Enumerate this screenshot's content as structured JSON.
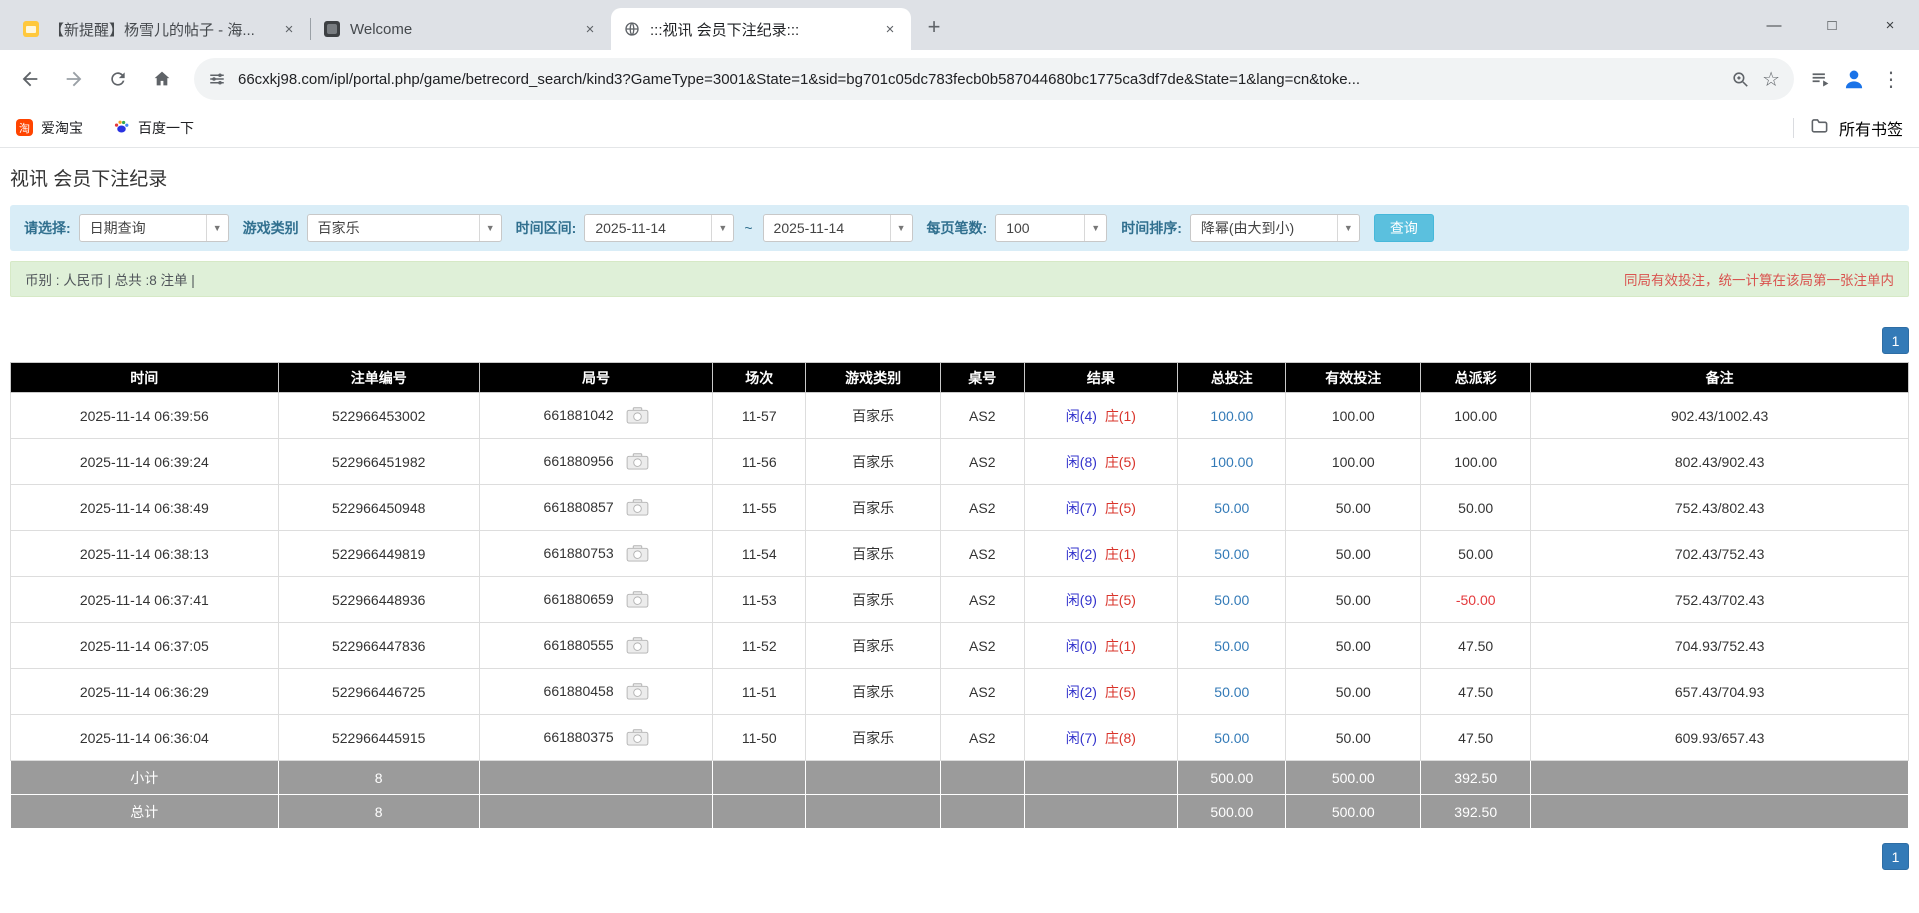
{
  "colors": {
    "accent_blue": "#337ab7",
    "filter_bg": "#d9edf7",
    "info_bg": "#dff0d8",
    "header_bg": "#000000",
    "summary_bg": "#9b9b9b",
    "player_blue": "#3333cc",
    "banker_red": "#d9342b",
    "negative_red": "#e4393c",
    "search_btn": "#5bc0de"
  },
  "icons": {
    "dropdown": "▼",
    "close": "×",
    "minimize": "—",
    "maximize": "□",
    "new_tab": "+",
    "star": "☆",
    "kebab": "⋮"
  },
  "browser": {
    "tabs": [
      {
        "title": "【新提醒】杨雪儿的帖子 - 海..."
      },
      {
        "title": "Welcome"
      },
      {
        "title": ":::视讯 会员下注纪录:::"
      }
    ],
    "omnibox": {
      "url": "66cxkj98.com/ipl/portal.php/game/betrecord_search/kind3?GameType=3001&State=1&sid=bg701c05dc783fecb0b587044680bc1775ca3df7de&State=1&lang=cn&toke..."
    },
    "bookmarks": {
      "items": [
        {
          "label": "爱淘宝",
          "badge": "淘"
        },
        {
          "label": "百度一下"
        }
      ],
      "all_bookmarks": "所有书签"
    }
  },
  "page": {
    "title": "视讯 会员下注纪录",
    "filters": {
      "select_label": "请选择:",
      "select_value": "日期查询",
      "game_type_label": "游戏类别",
      "game_type_value": "百家乐",
      "date_range_label": "时间区间:",
      "date_from": "2025-11-14",
      "date_to": "2025-11-14",
      "tilde": "~",
      "page_size_label": "每页笔数:",
      "page_size_value": "100",
      "sort_label": "时间排序:",
      "sort_value": "降幂(由大到小)",
      "search_button": "查询"
    },
    "info_bar": {
      "left": "币别 : 人民币 | 总共 :8 注单 |",
      "right": "同局有效投注，统一计算在该局第一张注单内"
    },
    "pagination": "1",
    "table": {
      "headers": [
        "时间",
        "注单编号",
        "局号",
        "场次",
        "游戏类别",
        "桌号",
        "结果",
        "总投注",
        "有效投注",
        "总派彩",
        "备注"
      ],
      "rows": [
        {
          "time": "2025-11-14 06:39:56",
          "bet_id": "522966453002",
          "round_id": "661881042",
          "session": "11-57",
          "game": "百家乐",
          "table": "AS2",
          "result_player": "闲(4)",
          "result_banker": "庄(1)",
          "total_bet": "100.00",
          "valid_bet": "100.00",
          "payout": "100.00",
          "note": "902.43/1002.43"
        },
        {
          "time": "2025-11-14 06:39:24",
          "bet_id": "522966451982",
          "round_id": "661880956",
          "session": "11-56",
          "game": "百家乐",
          "table": "AS2",
          "result_player": "闲(8)",
          "result_banker": "庄(5)",
          "total_bet": "100.00",
          "valid_bet": "100.00",
          "payout": "100.00",
          "note": "802.43/902.43"
        },
        {
          "time": "2025-11-14 06:38:49",
          "bet_id": "522966450948",
          "round_id": "661880857",
          "session": "11-55",
          "game": "百家乐",
          "table": "AS2",
          "result_player": "闲(7)",
          "result_banker": "庄(5)",
          "total_bet": "50.00",
          "valid_bet": "50.00",
          "payout": "50.00",
          "note": "752.43/802.43"
        },
        {
          "time": "2025-11-14 06:38:13",
          "bet_id": "522966449819",
          "round_id": "661880753",
          "session": "11-54",
          "game": "百家乐",
          "table": "AS2",
          "result_player": "闲(2)",
          "result_banker": "庄(1)",
          "total_bet": "50.00",
          "valid_bet": "50.00",
          "payout": "50.00",
          "note": "702.43/752.43"
        },
        {
          "time": "2025-11-14 06:37:41",
          "bet_id": "522966448936",
          "round_id": "661880659",
          "session": "11-53",
          "game": "百家乐",
          "table": "AS2",
          "result_player": "闲(9)",
          "result_banker": "庄(5)",
          "total_bet": "50.00",
          "valid_bet": "50.00",
          "payout": "-50.00",
          "note": "752.43/702.43"
        },
        {
          "time": "2025-11-14 06:37:05",
          "bet_id": "522966447836",
          "round_id": "661880555",
          "session": "11-52",
          "game": "百家乐",
          "table": "AS2",
          "result_player": "闲(0)",
          "result_banker": "庄(1)",
          "total_bet": "50.00",
          "valid_bet": "50.00",
          "payout": "47.50",
          "note": "704.93/752.43"
        },
        {
          "time": "2025-11-14 06:36:29",
          "bet_id": "522966446725",
          "round_id": "661880458",
          "session": "11-51",
          "game": "百家乐",
          "table": "AS2",
          "result_player": "闲(2)",
          "result_banker": "庄(5)",
          "total_bet": "50.00",
          "valid_bet": "50.00",
          "payout": "47.50",
          "note": "657.43/704.93"
        },
        {
          "time": "2025-11-14 06:36:04",
          "bet_id": "522966445915",
          "round_id": "661880375",
          "session": "11-50",
          "game": "百家乐",
          "table": "AS2",
          "result_player": "闲(7)",
          "result_banker": "庄(8)",
          "total_bet": "50.00",
          "valid_bet": "50.00",
          "payout": "47.50",
          "note": "609.93/657.43"
        }
      ],
      "subtotal": {
        "label": "小计",
        "count": "8",
        "total_bet": "500.00",
        "valid_bet": "500.00",
        "payout": "392.50"
      },
      "total": {
        "label": "总计",
        "count": "8",
        "total_bet": "500.00",
        "valid_bet": "500.00",
        "payout": "392.50"
      }
    }
  }
}
